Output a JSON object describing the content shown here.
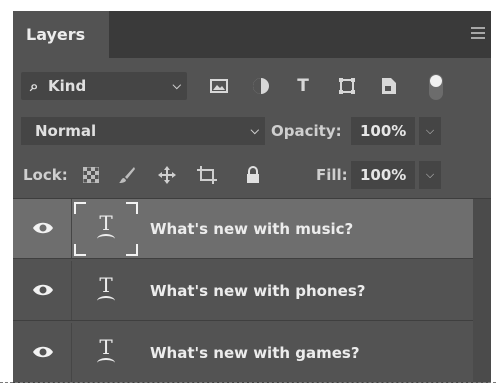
{
  "panel": {
    "tab_label": "Layers"
  },
  "filter": {
    "kind_label": "Kind",
    "icons": [
      "image-filter-icon",
      "adjustment-filter-icon",
      "type-filter-icon",
      "shape-filter-icon",
      "smart-object-filter-icon"
    ],
    "type_glyph": "T"
  },
  "blend": {
    "mode": "Normal",
    "opacity_label": "Opacity:",
    "opacity_value": "100%"
  },
  "lock": {
    "label": "Lock:",
    "fill_label": "Fill:",
    "fill_value": "100%"
  },
  "layers": [
    {
      "name": "What's new with music?",
      "selected": true,
      "type_glyph": "T"
    },
    {
      "name": "What's new with phones?",
      "selected": false,
      "type_glyph": "T"
    },
    {
      "name": "What's new with games?",
      "selected": false,
      "type_glyph": "T"
    }
  ]
}
